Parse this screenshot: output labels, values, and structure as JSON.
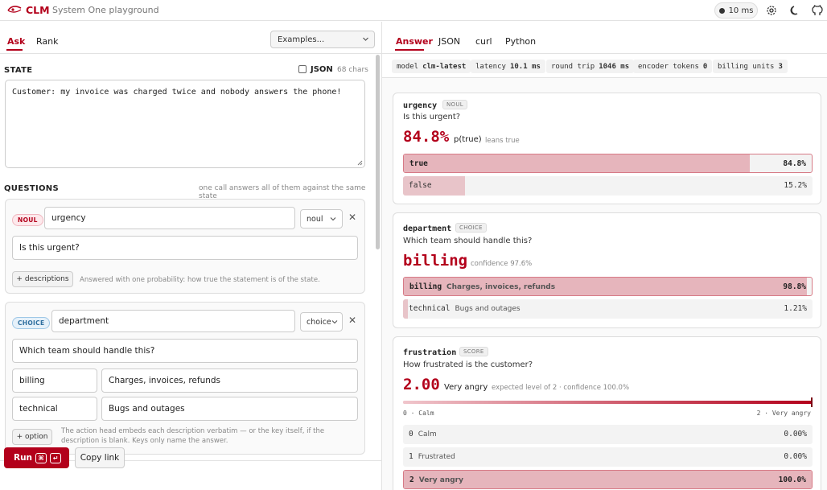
{
  "header": {
    "brand": "CLM",
    "subtitle": "System One playground",
    "latency_pill": "10 ms",
    "icons": [
      "logo-icon",
      "settings-icon",
      "moon-icon",
      "github-icon"
    ]
  },
  "left": {
    "tabs": [
      {
        "label": "Ask",
        "active": true
      },
      {
        "label": "Rank",
        "active": false
      }
    ],
    "examples_select": "Examples...",
    "state": {
      "label": "STATE",
      "json_toggle_label": "JSON",
      "json_checked": false,
      "chars": "68 chars",
      "text": "Customer: my invoice was charged twice and nobody answers the phone!"
    },
    "questions": {
      "label": "QUESTIONS",
      "hint": "one call answers all of them against the same state",
      "items": [
        {
          "badge": "NOUL",
          "key": "urgency",
          "type": "noul",
          "prompt": "Is this urgent?",
          "button": "+ descriptions",
          "hint": "Answered with one probability: how true the statement is of the state."
        },
        {
          "badge": "CHOICE",
          "key": "department",
          "type": "choice",
          "prompt": "Which team should handle this?",
          "options": [
            {
              "key": "billing",
              "description": "Charges, invoices, refunds"
            },
            {
              "key": "technical",
              "description": "Bugs and outages"
            }
          ],
          "button": "+ option",
          "hint": "The action head embeds each description verbatim — or the key itself, if the description is blank. Keys only name the answer."
        }
      ]
    },
    "run_button": "Run",
    "run_kbd": [
      "⌘",
      "↵"
    ],
    "copy_button": "Copy link"
  },
  "right": {
    "tabs": [
      {
        "label": "Answer",
        "active": true
      },
      {
        "label": "JSON",
        "active": false
      },
      {
        "label": "curl",
        "active": false
      },
      {
        "label": "Python",
        "active": false
      }
    ],
    "meta": [
      {
        "label": "model",
        "value": "clm-latest"
      },
      {
        "label": "latency",
        "value": "10.1 ms"
      },
      {
        "label": "round trip",
        "value": "1046 ms"
      },
      {
        "label": "encoder tokens",
        "value": "0"
      },
      {
        "label": "billing units",
        "value": "3"
      }
    ],
    "results": [
      {
        "name": "urgency",
        "type": "NOUL",
        "question": "Is this urgent?",
        "headline": "84.8%",
        "headline_unit": "p(true)",
        "headline_note": "leans true",
        "bars": [
          {
            "label": "true",
            "value": "84.8%",
            "fraction": 0.848,
            "winner": true
          },
          {
            "label": "false",
            "value": "15.2%",
            "fraction": 0.152,
            "winner": false
          }
        ]
      },
      {
        "name": "department",
        "type": "CHOICE",
        "question": "Which team should handle this?",
        "headline": "billing",
        "headline_note": "confidence 97.6%",
        "bars": [
          {
            "label": "billing",
            "description": "Charges, invoices, refunds",
            "value": "98.8%",
            "fraction": 0.988,
            "winner": true
          },
          {
            "label": "technical",
            "description": "Bugs and outages",
            "value": "1.21%",
            "fraction": 0.0121,
            "winner": false
          }
        ]
      },
      {
        "name": "frustration",
        "type": "SCORE",
        "question": "How frustrated is the customer?",
        "headline": "2.00",
        "headline_unit": "Very angry",
        "headline_note": "expected level of 2 · confidence 100.0%",
        "scale_level": 1.0,
        "scale_min": "0 · Calm",
        "scale_max": "2 · Very angry",
        "levels": [
          {
            "label": "0",
            "description": "Calm",
            "value": "0.00%",
            "fraction": 0.0,
            "winner": false
          },
          {
            "label": "1",
            "description": "Frustrated",
            "value": "0.00%",
            "fraction": 0.0,
            "winner": false
          },
          {
            "label": "2",
            "description": "Very angry",
            "value": "100.0%",
            "fraction": 1.0,
            "winner": true
          }
        ]
      }
    ]
  }
}
